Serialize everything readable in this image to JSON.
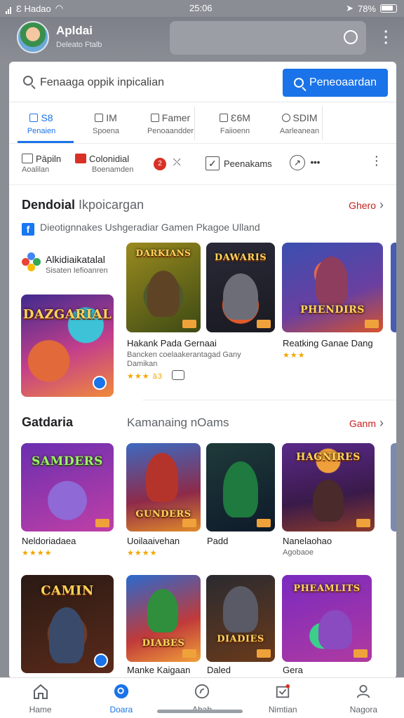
{
  "status_bar": {
    "carrier": "Ɛ Hadao",
    "time": "25:06",
    "battery": "78%"
  },
  "app_header": {
    "title": "Apldai",
    "subtitle": "Deleato Ftalb"
  },
  "search": {
    "placeholder": "Fenaaga oppik inpicalian",
    "button_label": "Peneoaardan"
  },
  "tabs": [
    {
      "label": "S8",
      "sub": "Penaien"
    },
    {
      "label": "IM",
      "sub": "Spoena"
    },
    {
      "label": "Famer",
      "sub": "Penoaandder"
    },
    {
      "label": "Ɛ6M",
      "sub": "Faiioenn"
    },
    {
      "label": "SDIM",
      "sub": "Aarleanean"
    }
  ],
  "chips": [
    {
      "label": "Pāpiln",
      "sub": "Aoalilan"
    },
    {
      "label": "Colonidial",
      "sub": "Boenamden"
    },
    {
      "badge": "2"
    },
    {
      "label": "Peenakams"
    }
  ],
  "section1": {
    "title_bold": "Dendoial",
    "title_light": "Ikpoicargan",
    "more": "Ghero",
    "fb_line": "Dieotignnakes Ushgeradiar  Gamen  Pkagoe Ulland",
    "brand_name": "Alkidiaikatalal",
    "brand_sub": "Sisaten Iefioanren",
    "featured_title": "DAZGARIAL",
    "games": [
      {
        "art_title": "DARKIANS",
        "name": "Hakank Pada Gernaai",
        "sub": "Bancken coelaakerantagad Gany Damikan",
        "stars": "★★★ ā3"
      },
      {
        "art_title": "DAWARIS"
      },
      {
        "art_title": "PHENDIRS",
        "name": "Reatking Ganae Dang",
        "stars": "★★★"
      }
    ]
  },
  "section2": {
    "title_bold": "Gatdaria",
    "title_light": "Kamanaing nOams",
    "more": "Ganm",
    "row1": [
      {
        "art_title": "SAMDERS",
        "name": "Neldoriadaea",
        "stars": "★★★★"
      },
      {
        "art_title": "GUNDERS",
        "name": "Uoilaaivehan",
        "stars": "★★★★"
      },
      {
        "art_title": "",
        "name": "Padd"
      },
      {
        "art_title": "HAGNIRES",
        "name": "Nanelaohao",
        "sub": "Agobaoe"
      }
    ],
    "row2": [
      {
        "art_title": "CAMIN"
      },
      {
        "art_title": "DIABES",
        "name": "Manke Kaigaan"
      },
      {
        "art_title": "DIADIES",
        "name": "Daled"
      },
      {
        "art_title": "PHEAMLITS",
        "name": "Gera"
      }
    ]
  },
  "bottom_nav": [
    {
      "label": "Hame"
    },
    {
      "label": "Doara"
    },
    {
      "label": "Ahab"
    },
    {
      "label": "Nimtian"
    },
    {
      "label": "Nagora"
    }
  ],
  "colors": {
    "accent": "#1a73e8",
    "more_link": "#c5221f",
    "stars": "#f2a600"
  }
}
